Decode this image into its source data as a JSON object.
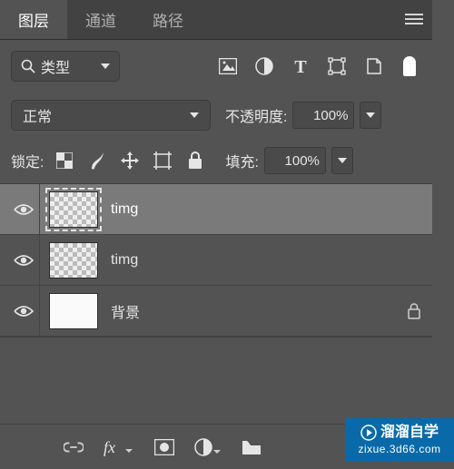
{
  "tabs": [
    {
      "label": "图层",
      "active": true
    },
    {
      "label": "通道",
      "active": false
    },
    {
      "label": "路径",
      "active": false
    }
  ],
  "filter": {
    "type_label": "类型"
  },
  "blend": {
    "mode": "正常",
    "opacity_label": "不透明度:",
    "opacity_value": "100%"
  },
  "lock": {
    "label": "锁定:",
    "fill_label": "填充:",
    "fill_value": "100%"
  },
  "layers": [
    {
      "name": "timg",
      "visible": true,
      "selected": true,
      "thumb": "checker",
      "locked": false
    },
    {
      "name": "timg",
      "visible": true,
      "selected": false,
      "thumb": "checker",
      "locked": false
    },
    {
      "name": "背景",
      "visible": true,
      "selected": false,
      "thumb": "white",
      "locked": true
    }
  ],
  "watermark": {
    "title": "溜溜自学",
    "url": "zixue.3d66.com"
  }
}
